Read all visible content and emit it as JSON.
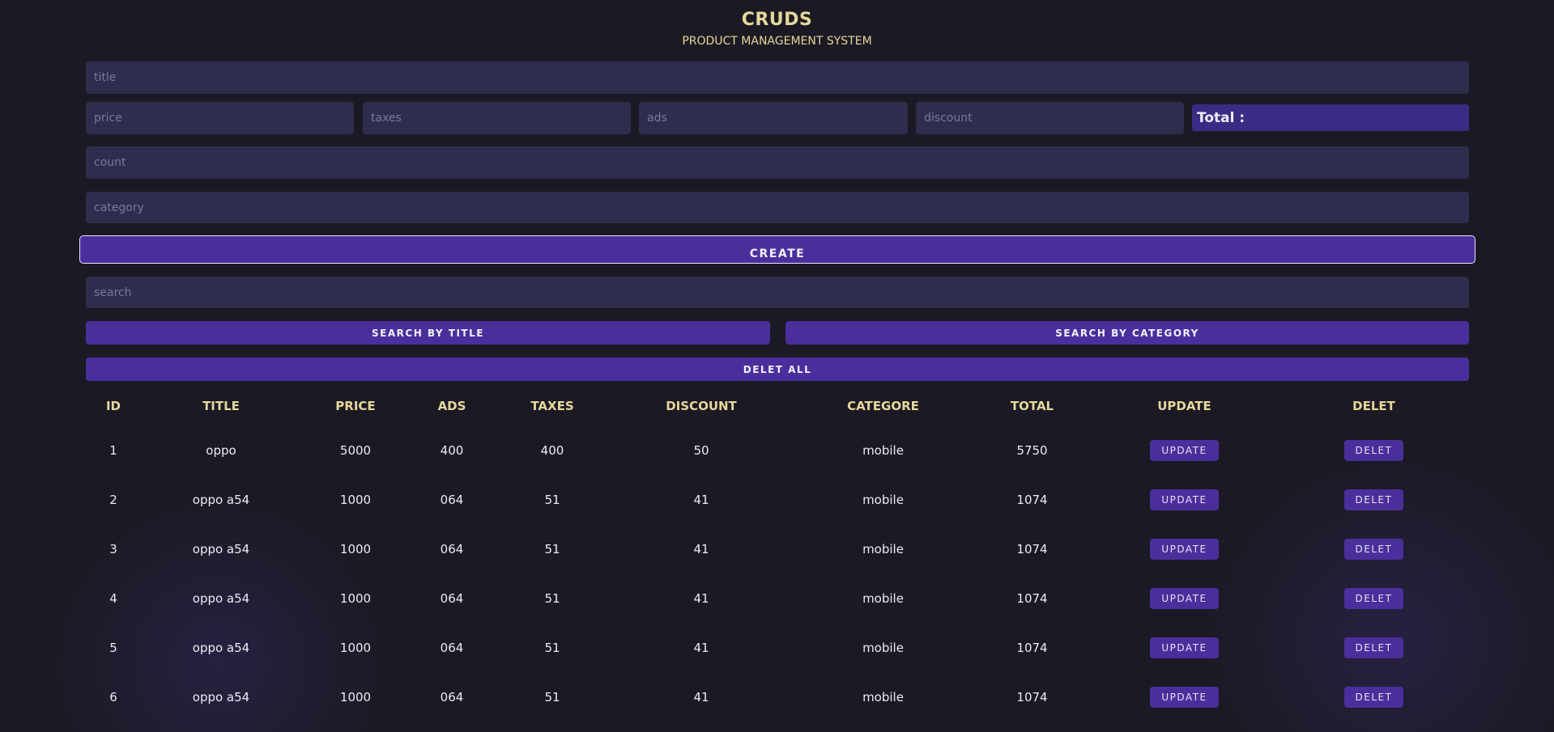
{
  "header": {
    "title": "CRUDS",
    "subtitle": "PRODUCT MANAGEMENT SYSTEM"
  },
  "form": {
    "title_placeholder": "title",
    "price_placeholder": "price",
    "taxes_placeholder": "taxes",
    "ads_placeholder": "ads",
    "discount_placeholder": "discount",
    "total_label": "Total :",
    "count_placeholder": "count",
    "category_placeholder": "category",
    "create_label": "CREATE"
  },
  "search": {
    "placeholder": "search",
    "by_title_label": "SEARCH BY TITLE",
    "by_category_label": "SEARCH BY CATEGORY",
    "delete_all_label": "DELET ALL"
  },
  "table": {
    "headers": [
      "ID",
      "TITLE",
      "PRICE",
      "ADS",
      "TAXES",
      "DISCOUNT",
      "CATEGORE",
      "TOTAL",
      "UPDATE",
      "DELET"
    ],
    "update_label": "UPDATE",
    "delete_label": "DELET",
    "rows": [
      {
        "id": "1",
        "title": "oppo",
        "price": "5000",
        "ads": "400",
        "taxes": "400",
        "discount": "50",
        "category": "mobile",
        "total": "5750"
      },
      {
        "id": "2",
        "title": "oppo a54",
        "price": "1000",
        "ads": "064",
        "taxes": "51",
        "discount": "41",
        "category": "mobile",
        "total": "1074"
      },
      {
        "id": "3",
        "title": "oppo a54",
        "price": "1000",
        "ads": "064",
        "taxes": "51",
        "discount": "41",
        "category": "mobile",
        "total": "1074"
      },
      {
        "id": "4",
        "title": "oppo a54",
        "price": "1000",
        "ads": "064",
        "taxes": "51",
        "discount": "41",
        "category": "mobile",
        "total": "1074"
      },
      {
        "id": "5",
        "title": "oppo a54",
        "price": "1000",
        "ads": "064",
        "taxes": "51",
        "discount": "41",
        "category": "mobile",
        "total": "1074"
      },
      {
        "id": "6",
        "title": "oppo a54",
        "price": "1000",
        "ads": "064",
        "taxes": "51",
        "discount": "41",
        "category": "mobile",
        "total": "1074"
      }
    ]
  },
  "colors": {
    "background": "#1b1a24",
    "input": "#2e2d4d",
    "button": "#4a2f9c",
    "accent_text": "#e6d79a"
  }
}
